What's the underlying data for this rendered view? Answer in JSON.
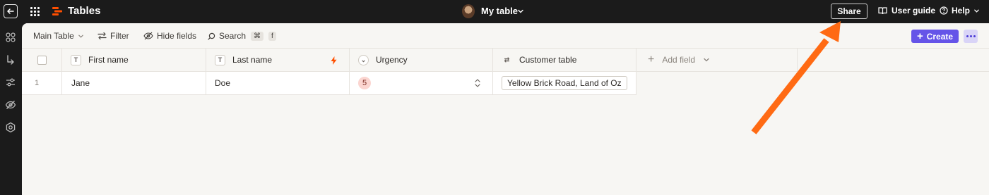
{
  "topbar": {
    "app_title": "Tables",
    "table_name": "My table",
    "share_label": "Share",
    "user_guide_label": "User guide",
    "help_label": "Help"
  },
  "toolbar": {
    "view_label": "Main Table",
    "filter_label": "Filter",
    "hide_fields_label": "Hide fields",
    "search_label": "Search",
    "search_shortcut_key1": "⌘",
    "search_shortcut_key2": "f",
    "create_label": "Create"
  },
  "columns": [
    {
      "label": "First name",
      "type_icon": "T"
    },
    {
      "label": "Last name",
      "type_icon": "T"
    },
    {
      "label": "Urgency",
      "type_icon": "⌄"
    },
    {
      "label": "Customer table",
      "type_icon": "⇄"
    }
  ],
  "add_field_label": "Add field",
  "rows": [
    {
      "index": "1",
      "first_name": "Jane",
      "last_name": "Doe",
      "urgency": "5",
      "customer": "Yellow Brick Road, Land of Oz"
    }
  ],
  "colors": {
    "accent": "#6554e8",
    "brand": "#ff4f00",
    "annotation_arrow": "#ff6a13"
  }
}
